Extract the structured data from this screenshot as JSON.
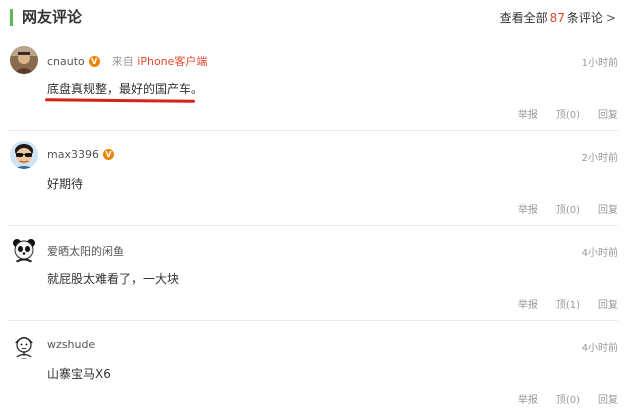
{
  "header": {
    "title": "网友评论",
    "more_prefix": "查看全部",
    "count": "87",
    "more_suffix": "条评论",
    "chevron": ">"
  },
  "actions": {
    "report": "举报",
    "reply": "回复"
  },
  "comments": [
    {
      "user": "cnauto",
      "verified": true,
      "from_prefix": "来自",
      "from_device": "iPhone客户端",
      "time": "1小时前",
      "text": "底盘真规整，最好的国产车。",
      "likes": "顶(0)",
      "avatar_icon": "user-avatar-icon"
    },
    {
      "user": "max3396",
      "verified": true,
      "time": "2小时前",
      "text": "好期待",
      "likes": "顶(0)",
      "avatar_icon": "sunglasses-avatar-icon"
    },
    {
      "user": "爱晒太阳的闲鱼",
      "verified": false,
      "time": "4小时前",
      "text": "就屁股太难看了，一大块",
      "likes": "顶(1)",
      "avatar_icon": "panda-avatar-icon"
    },
    {
      "user": "wzshude",
      "verified": false,
      "time": "4小时前",
      "text": "山寨宝马X6",
      "likes": "顶(0)",
      "avatar_icon": "default-user-avatar-icon"
    }
  ],
  "colors": {
    "accent_bar": "#5cb85c",
    "count": "#e2492f",
    "verified_badge": "#f08200",
    "underline": "#d8231b"
  }
}
